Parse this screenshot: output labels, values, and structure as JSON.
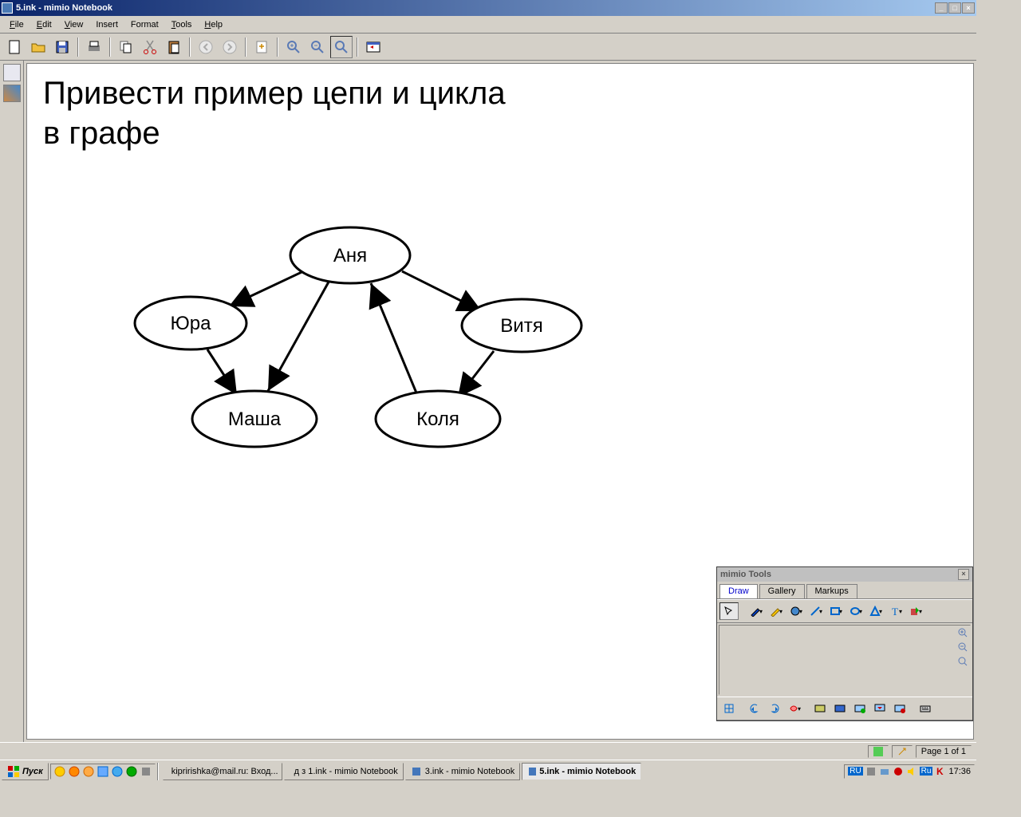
{
  "titlebar": {
    "text": "5.ink - mimio Notebook"
  },
  "menu": {
    "file": "File",
    "edit": "Edit",
    "view": "View",
    "insert": "Insert",
    "format": "Format",
    "tools": "Tools",
    "help": "Help"
  },
  "slide": {
    "title_line1": "Привести пример цепи и цикла",
    "title_line2": "в графе",
    "nodes": {
      "anya": "Аня",
      "yura": "Юра",
      "vitya": "Витя",
      "masha": "Маша",
      "kolya": "Коля"
    }
  },
  "mimio_tools": {
    "title": "mimio Tools",
    "tabs": {
      "draw": "Draw",
      "gallery": "Gallery",
      "markups": "Markups"
    }
  },
  "status": {
    "page": "Page 1 of 1"
  },
  "taskbar": {
    "start": "Пуск",
    "tasks": [
      "kipririshka@mail.ru: Вход...",
      "д з 1.ink - mimio Notebook",
      "3.ink - mimio Notebook",
      "5.ink - mimio Notebook"
    ],
    "lang1": "RU",
    "lang2": "Ru",
    "clock": "17:36"
  }
}
